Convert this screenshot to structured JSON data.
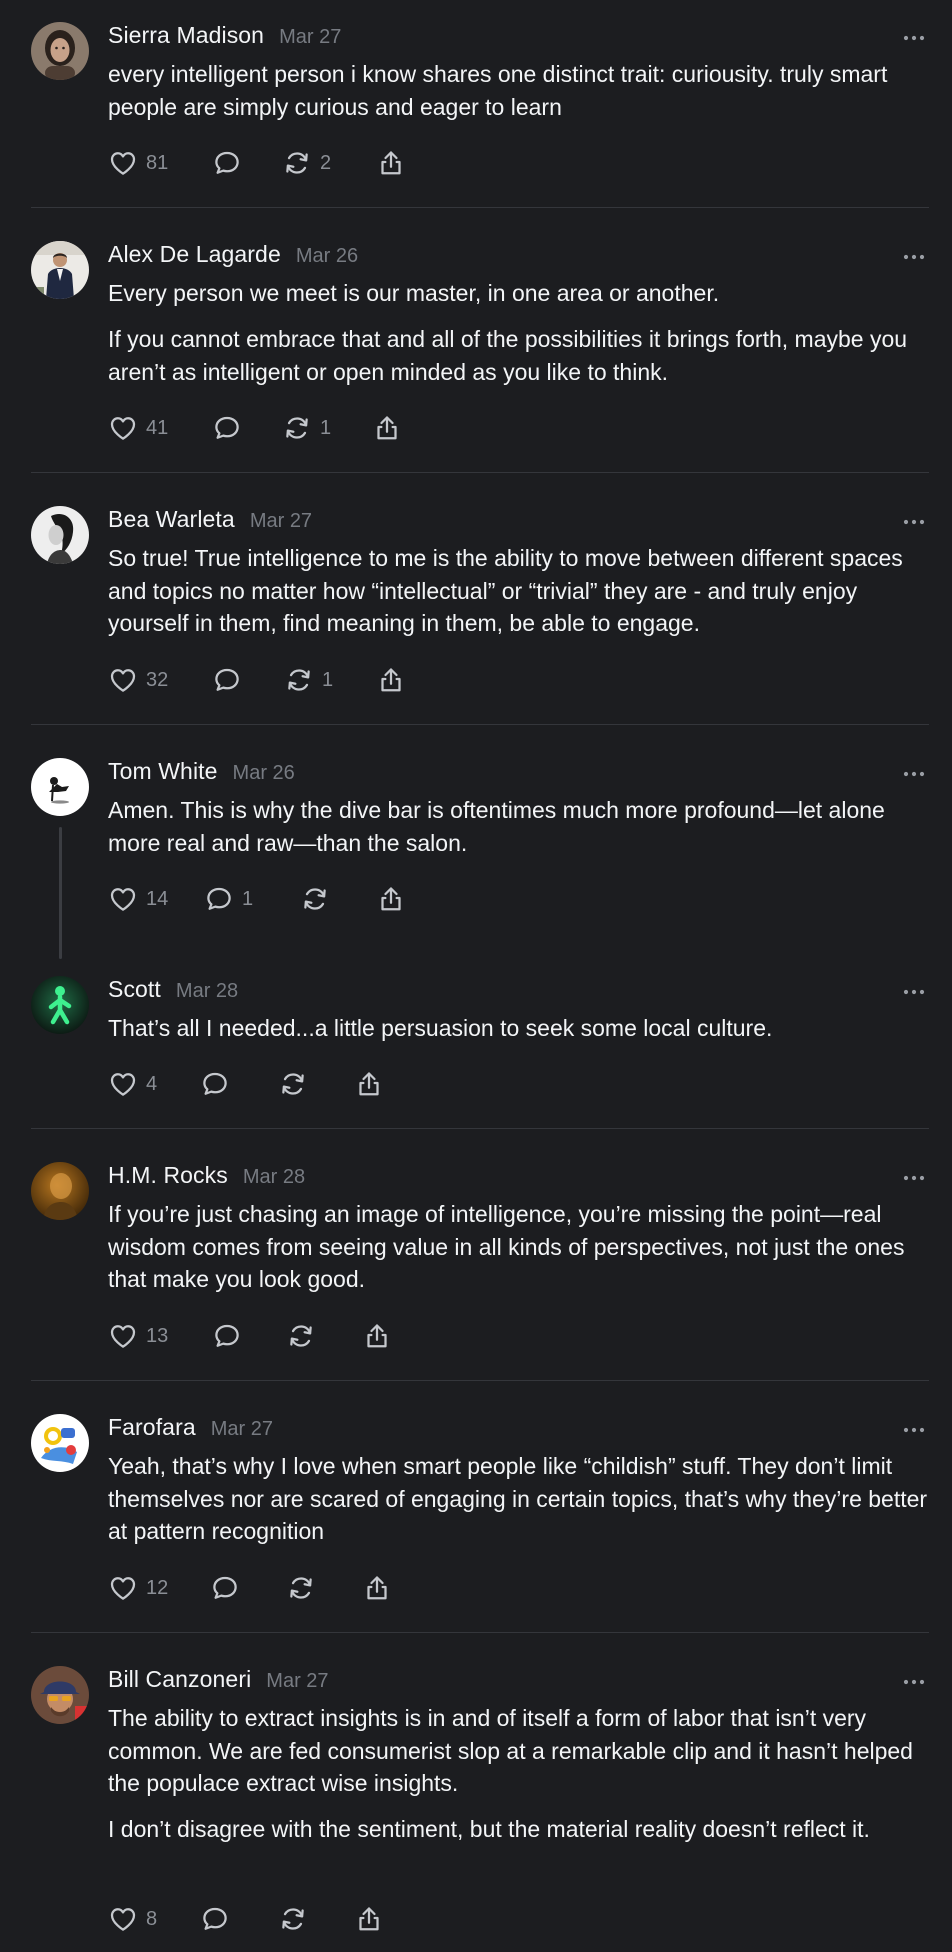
{
  "more_icon": "more-dots-icon",
  "colors": {
    "background": "#1c1d20",
    "text": "#f3f5f7",
    "muted": "#777b82",
    "divider": "#34363b"
  },
  "posts": [
    {
      "username": "Sierra Madison",
      "date": "Mar 27",
      "paragraphs": [
        "every intelligent person i know shares one distinct trait: curiousity. truly smart people are simply curious and eager to learn"
      ],
      "likes": "81",
      "replies": "",
      "reposts": "2"
    },
    {
      "username": "Alex De Lagarde",
      "date": "Mar 26",
      "paragraphs": [
        "Every person we meet is our master, in one area or another.",
        "If you cannot embrace that and all of the possibilities it brings forth, maybe you aren’t as intelligent or open minded as you like to think."
      ],
      "likes": "41",
      "replies": "",
      "reposts": "1"
    },
    {
      "username": "Bea Warleta",
      "date": "Mar 27",
      "paragraphs": [
        "So true! True intelligence to me is the ability to move between different spaces and topics no matter how “intellectual” or “trivial” they are - and truly enjoy yourself in them, find meaning in them, be able to engage."
      ],
      "likes": "32",
      "replies": "",
      "reposts": "1"
    },
    {
      "username": "Tom White",
      "date": "Mar 26",
      "paragraphs": [
        "Amen. This is why the dive bar is oftentimes much more profound—let alone more real and raw—than the salon."
      ],
      "likes": "14",
      "replies": "1",
      "reposts": ""
    },
    {
      "username": "Scott",
      "date": "Mar 28",
      "paragraphs": [
        "That’s all I needed...a little persuasion to seek some local culture."
      ],
      "likes": "4",
      "replies": "",
      "reposts": ""
    },
    {
      "username": "H.M. Rocks",
      "date": "Mar 28",
      "paragraphs": [
        "If you’re just chasing an image of intelligence, you’re missing the point—real wisdom comes from seeing value in all kinds of perspectives, not just the ones that make you look good."
      ],
      "likes": "13",
      "replies": "",
      "reposts": ""
    },
    {
      "username": "Farofara",
      "date": "Mar 27",
      "paragraphs": [
        "Yeah, that’s why I love when smart people like “childish” stuff. They don’t limit themselves nor are scared of engaging in certain topics, that’s why they’re better at pattern recognition"
      ],
      "likes": "12",
      "replies": "",
      "reposts": ""
    },
    {
      "username": "Bill Canzoneri",
      "date": "Mar 27",
      "paragraphs": [
        "The ability to extract insights is in and of itself a form of labor that isn’t very common. We are fed consumerist slop at a remarkable clip and it hasn’t helped the populace extract wise insights.",
        "I don’t disagree with the sentiment, but the material reality doesn’t reflect it."
      ],
      "likes": "8",
      "replies": "",
      "reposts": ""
    }
  ]
}
